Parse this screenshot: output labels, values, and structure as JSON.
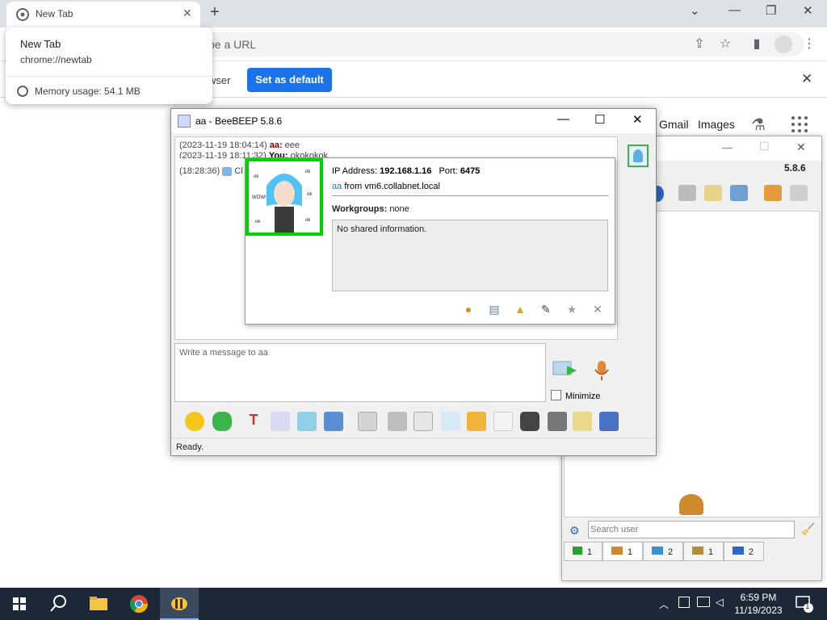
{
  "browser": {
    "tab_title": "New Tab",
    "tab_close": "✕",
    "new_tab": "+",
    "window_controls": {
      "chevron": "⌄",
      "minimize": "—",
      "restore": "❐",
      "close": "✕"
    },
    "omnibox_placeholder": "pe a URL",
    "infobar_text": "wser",
    "set_default_label": "Set as default",
    "infobar_close": "✕",
    "tooltip": {
      "title": "New Tab",
      "url": "chrome://newtab",
      "memory": "Memory usage: 54.1 MB"
    },
    "ntp": {
      "gmail": "Gmail",
      "images": "Images"
    }
  },
  "chat_window": {
    "title": "aa - BeeBEEP 5.8.6",
    "controls": {
      "minimize": "—",
      "maximize": "☐",
      "close": "✕"
    },
    "messages": [
      {
        "time": "(2023-11-19 18:04:14)",
        "user": "aa:",
        "text": " eee"
      },
      {
        "time": "(2023-11-19 18:11:32)",
        "user": "You:",
        "text": " okokokok"
      },
      {
        "time": "(18:28:36)",
        "user": "",
        "text": "Cl"
      }
    ],
    "message_placeholder": "Write a message to aa",
    "minimize_label": "Minimize",
    "status": "Ready."
  },
  "user_popup": {
    "ip_label": "IP Address:",
    "ip_value": "192.168.1.16",
    "port_label": "Port:",
    "port_value": "6475",
    "user_name": "aa",
    "from_text": "from vm6.collabnet.local",
    "workgroups_label": "Workgroups:",
    "workgroups_value": "none",
    "shared_info": "No shared information."
  },
  "back_window": {
    "version": "5.8.6",
    "search_placeholder": "Search user",
    "tabs": [
      {
        "icon": "users-online-icon",
        "count": "1"
      },
      {
        "icon": "users-icon",
        "count": "1"
      },
      {
        "icon": "chats-icon",
        "count": "2"
      },
      {
        "icon": "groups-icon",
        "count": "1"
      },
      {
        "icon": "share-icon",
        "count": "2"
      }
    ]
  },
  "taskbar": {
    "time": "6:59 PM",
    "date": "11/19/2023",
    "notification_count": "1"
  }
}
